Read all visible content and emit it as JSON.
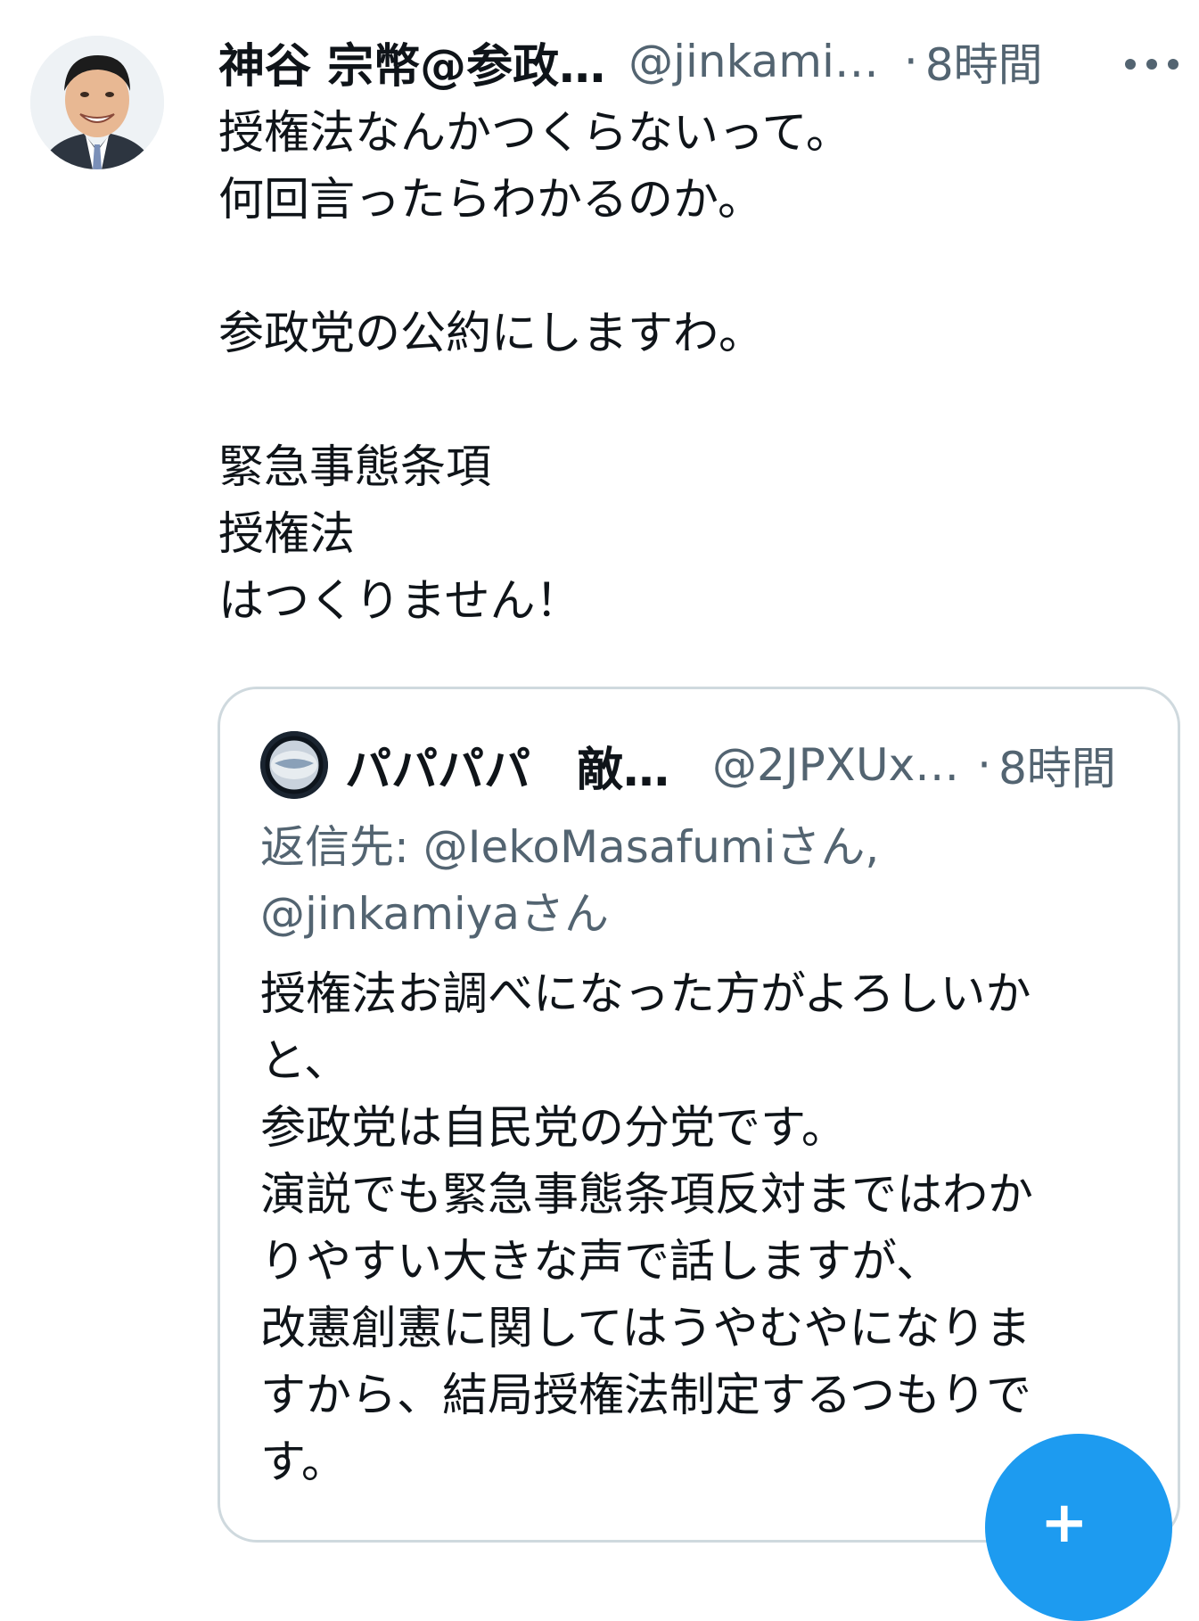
{
  "tweet": {
    "display_name": "神谷 宗幣@参政…",
    "handle": "@jinkami…",
    "separator": "·",
    "time": "8時間",
    "lines": [
      "授権法なんかつくらないって。",
      "何回言ったらわかるのか。",
      "",
      "参政党の公約にしますわ。",
      "",
      "緊急事態条項",
      "授権法",
      "はつくりません！"
    ]
  },
  "quoted_tweet": {
    "display_name": "パパパパ　敵…",
    "handle": "@2JPXUx…",
    "separator": "·",
    "time": "8時間",
    "reply_to": [
      "返信先: @IekoMasafumiさん,",
      "@jinkamiyaさん"
    ],
    "lines": [
      "授権法お調べになった方がよろしいか",
      "と、",
      "参政党は自民党の分党です。",
      "演説でも緊急事態条項反対まではわか",
      "りやすい大きな声で話しますが、",
      "改憲創憲に関してはうやむやになりま",
      "すから、結局授権法制定するつもりで",
      "す。"
    ]
  },
  "icons": {
    "more": "more-horizontal-icon",
    "compose": "compose-plus-icon"
  },
  "colors": {
    "text_primary": "#0f1419",
    "text_secondary": "#536471",
    "card_border": "#cfd9de",
    "accent": "#1d9bf0"
  }
}
